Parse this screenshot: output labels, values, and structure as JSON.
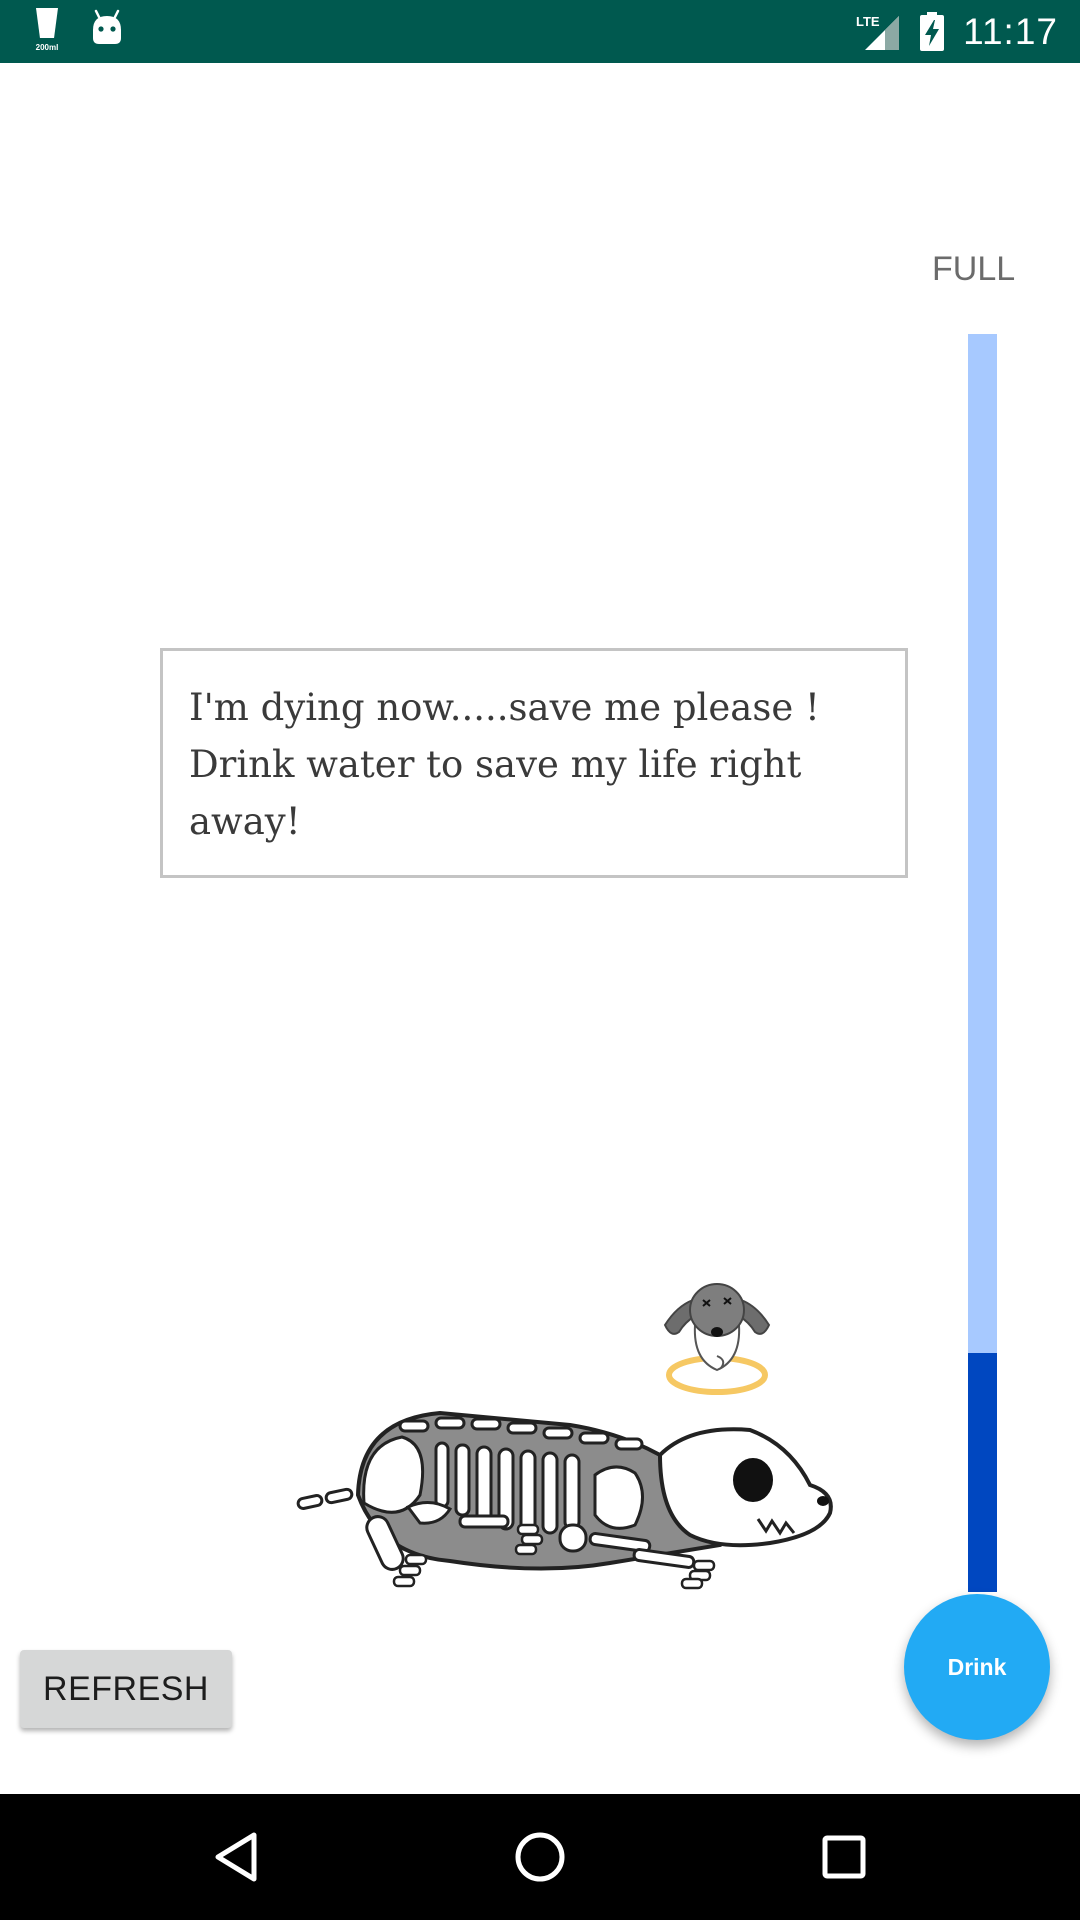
{
  "status_bar": {
    "notification_icons": [
      "cup-icon",
      "android-icon"
    ],
    "cup_label": "200ml",
    "network_label": "LTE",
    "network_icon": "signal-icon",
    "battery_icon": "battery-charging-icon",
    "time": "11:17",
    "background_color": "#00594f"
  },
  "meter": {
    "label": "FULL",
    "level_fraction": 0.19,
    "track_color": "#a7c9ff",
    "fill_color": "#0047c0"
  },
  "message": {
    "text": "I'm dying now.....save me please ! Drink water to save my life right away!"
  },
  "illustration": {
    "subject_icons": [
      "ghost-dog-icon",
      "skeleton-dog-icon"
    ],
    "halo_color": "#f6c863"
  },
  "buttons": {
    "refresh_label": "REFRESH",
    "drink_label": "Drink",
    "drink_color": "#22aaf4"
  },
  "nav_bar": {
    "icons": [
      "back-icon",
      "home-icon",
      "recents-icon"
    ]
  }
}
